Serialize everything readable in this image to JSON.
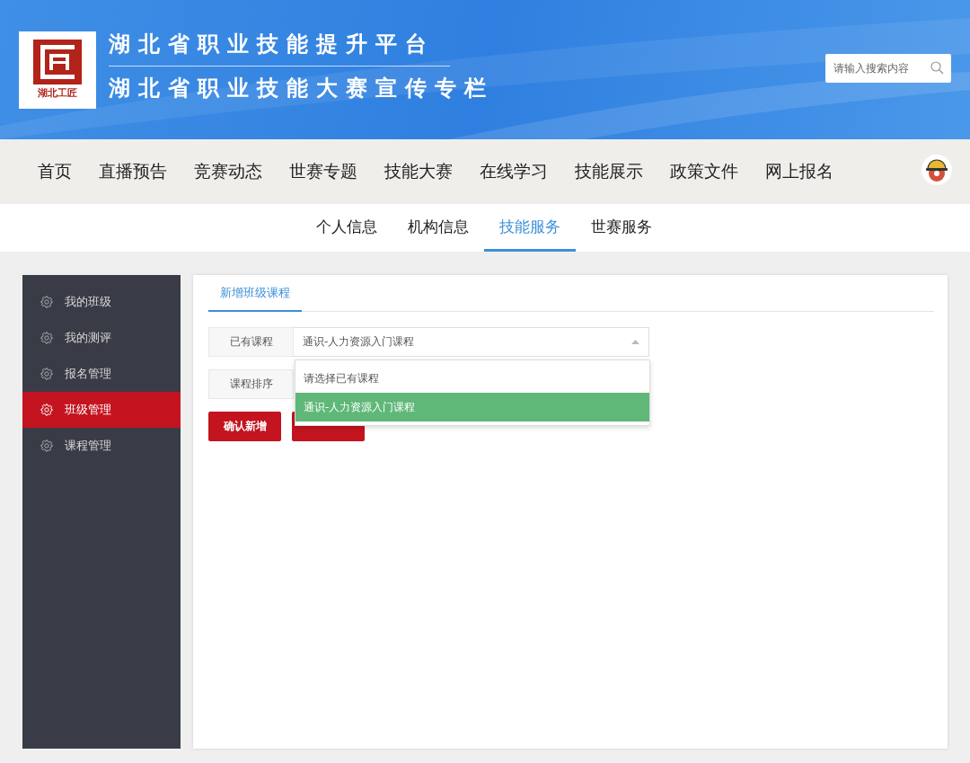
{
  "header": {
    "logo_text": "湖北工匠",
    "title_lines": [
      "湖北省职业技能提升平台",
      "湖北省职业技能大赛宣传专栏"
    ],
    "search": {
      "placeholder": "请输入搜索内容"
    }
  },
  "nav": {
    "items": [
      {
        "label": "首页"
      },
      {
        "label": "直播预告"
      },
      {
        "label": "竞赛动态"
      },
      {
        "label": "世赛专题"
      },
      {
        "label": "技能大赛"
      },
      {
        "label": "在线学习"
      },
      {
        "label": "技能展示"
      },
      {
        "label": "政策文件"
      },
      {
        "label": "网上报名"
      }
    ]
  },
  "sub_tabs": [
    {
      "label": "个人信息",
      "selected": false
    },
    {
      "label": "机构信息",
      "selected": false
    },
    {
      "label": "技能服务",
      "selected": true
    },
    {
      "label": "世赛服务",
      "selected": false
    }
  ],
  "sidebar": {
    "items": [
      {
        "label": "我的班级",
        "selected": false
      },
      {
        "label": "我的测评",
        "selected": false
      },
      {
        "label": "报名管理",
        "selected": false
      },
      {
        "label": "班级管理",
        "selected": true
      },
      {
        "label": "课程管理",
        "selected": false
      }
    ]
  },
  "panel": {
    "tabs": [
      {
        "label": "新增班级课程",
        "selected": true
      }
    ],
    "form": [
      {
        "label": "已有课程",
        "value": "通识-人力资源入门课程",
        "expanded": true
      },
      {
        "label": "课程排序"
      }
    ],
    "dropdown_options": [
      {
        "label": "请选择已有课程",
        "selected": false
      },
      {
        "label": "通识-人力资源入门课程",
        "selected": true
      }
    ],
    "buttons": [
      {
        "kind": "labeled",
        "label": "确认新增"
      },
      {
        "kind": "covered"
      }
    ]
  }
}
